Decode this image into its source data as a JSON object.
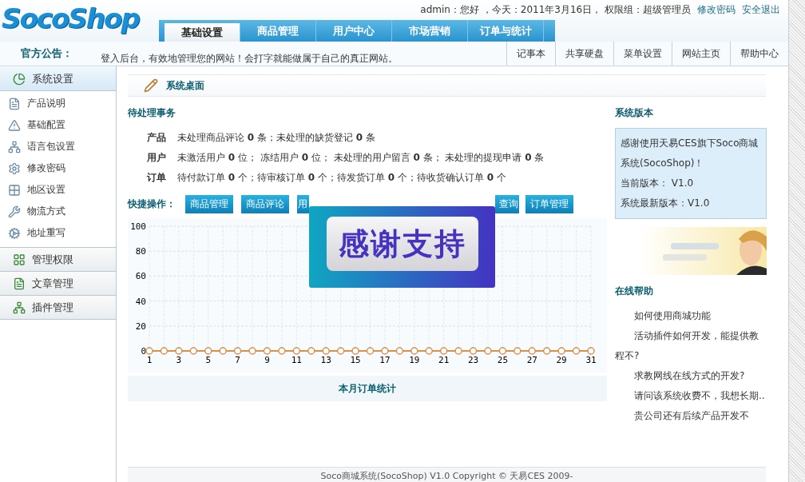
{
  "header": {
    "logo": "SocoShop",
    "user_info": "admin：您好 ，今天：2011年3月16日， 权限组：超级管理员",
    "links": [
      "修改密码",
      "安全退出"
    ]
  },
  "tabs": [
    {
      "label": "基础设置",
      "selected": true
    },
    {
      "label": "商品管理",
      "selected": false
    },
    {
      "label": "用户中心",
      "selected": false
    },
    {
      "label": "市场营销",
      "selected": false
    },
    {
      "label": "订单与统计",
      "selected": false
    }
  ],
  "notice": {
    "label": "官方公告：",
    "text": "登入后台，有效地管理您的网站！会打字就能做属于自己的真正网站。"
  },
  "top_links": [
    "记事本",
    "共享硬盘",
    "菜单设置",
    "网站主页",
    "帮助中心"
  ],
  "sidebar": [
    {
      "label": "系统设置",
      "expanded": true,
      "children": [
        "产品说明",
        "基础配置",
        "语言包设置",
        "修改密码",
        "地区设置",
        "物流方式",
        "地址重写"
      ]
    },
    {
      "label": "管理权限",
      "expanded": false
    },
    {
      "label": "文章管理",
      "expanded": false
    },
    {
      "label": "插件管理",
      "expanded": false
    }
  ],
  "page_title": "系统桌面",
  "pending": {
    "title": "待处理事务",
    "rows": [
      {
        "label": "产品",
        "text": "未处理商品评论 **0** 条；未处理的缺货登记 **0** 条"
      },
      {
        "label": "用户",
        "text": "未激活用户 **0** 位； 冻结用户 **0** 位； 未处理的用户留言 **0** 条； 未处理的提现申请 **0** 条"
      },
      {
        "label": "订单",
        "text": "待付款订单 **0** 个；待审核订单 **0** 个；待发货订单 **0** 个；待收货确认订单 **0** 个"
      }
    ]
  },
  "quick": {
    "label": "快捷操作：",
    "buttons": [
      {
        "label": "商品管理",
        "kind": "full"
      },
      {
        "label": "商品评论",
        "kind": "full"
      },
      {
        "label": "用",
        "kind": "cut_right"
      },
      {
        "label": "查询",
        "kind": "cut_left"
      },
      {
        "label": "订单管理",
        "kind": "full"
      }
    ]
  },
  "popup": {
    "text": "感谢支持"
  },
  "chart": {
    "caption": "本月订单统计",
    "chart_data": {
      "type": "line",
      "x": [
        1,
        2,
        3,
        4,
        5,
        6,
        7,
        8,
        9,
        10,
        11,
        12,
        13,
        14,
        15,
        16,
        17,
        18,
        19,
        20,
        21,
        22,
        23,
        24,
        25,
        26,
        27,
        28,
        29,
        30,
        31
      ],
      "series": [
        {
          "color": "#d9904a",
          "marker": "circle",
          "values": [
            0,
            0,
            0,
            0,
            0,
            0,
            0,
            0,
            0,
            0,
            0,
            0,
            0,
            0,
            0,
            0,
            0,
            0,
            0,
            0,
            0,
            0,
            0,
            0,
            0,
            0,
            0,
            0,
            0,
            0,
            0
          ]
        }
      ],
      "xlim": [
        1,
        31
      ],
      "grid": true,
      "ylim": [
        0,
        100
      ],
      "yticks": [
        0,
        20,
        40,
        60,
        80,
        100
      ],
      "xticks": [
        1,
        3,
        5,
        7,
        9,
        11,
        13,
        15,
        17,
        19,
        21,
        23,
        25,
        27,
        29,
        31
      ]
    }
  },
  "version": {
    "title": "系统版本",
    "lines": [
      "感谢使用天易CES旗下Soco商城系统(SocoShop)！",
      "当前版本： V1.0",
      "系统最新版本：V1.0"
    ]
  },
  "help": {
    "title": "在线帮助",
    "items": [
      "如何使用商城功能",
      "活动插件如何开发，能提供教程不?",
      "求教网线在线方式的开发?",
      "请问该系统收费不，我想长期..",
      "贵公司还有后续产品开发不"
    ]
  },
  "footer": "Soco商城系统(SocoShop) V1.0 Copyright © 天易CES 2009-"
}
